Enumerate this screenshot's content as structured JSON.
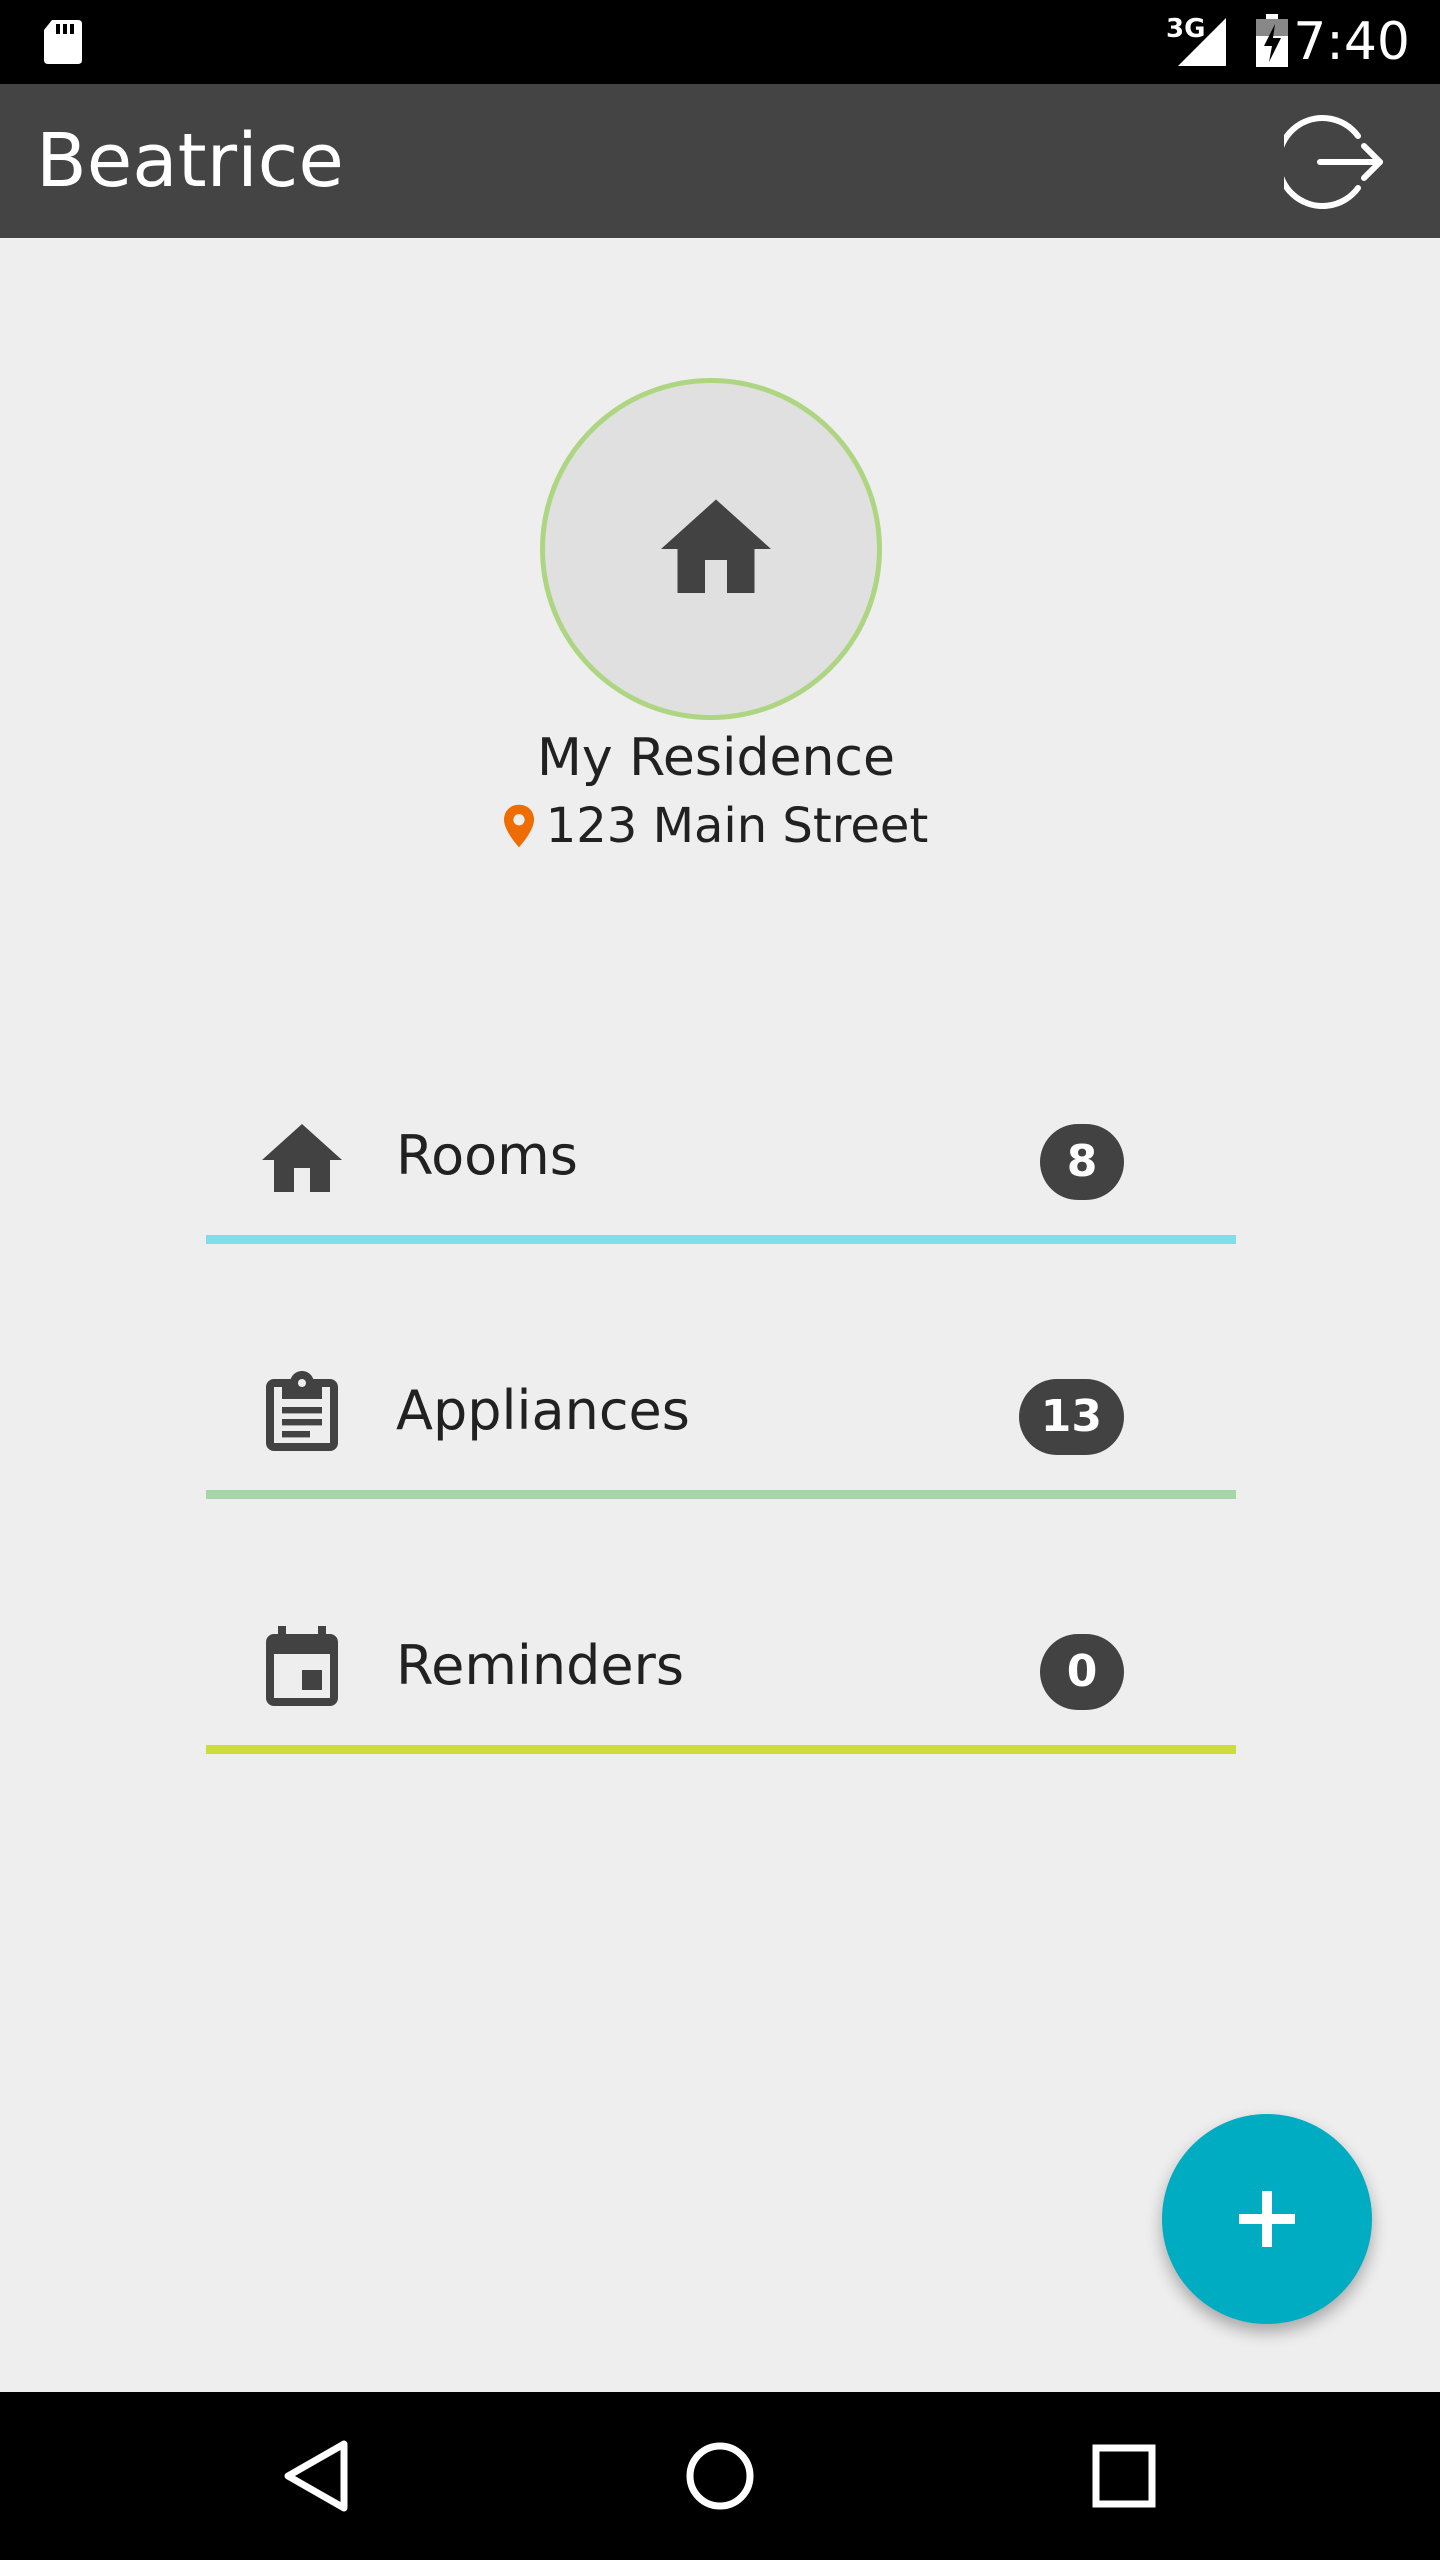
{
  "status_bar": {
    "network_type": "3G",
    "time": "7:40"
  },
  "app_bar": {
    "title": "Beatrice",
    "logout_icon": "logout-icon"
  },
  "residence": {
    "name": "My Residence",
    "address": "123 Main Street",
    "avatar_icon": "home-icon",
    "avatar_border_color": "#aed581",
    "pin_color": "#ef6c00"
  },
  "menu": [
    {
      "label": "Rooms",
      "count": "8",
      "icon": "home-icon",
      "accent_color": "#80deea"
    },
    {
      "label": "Appliances",
      "count": "13",
      "icon": "clipboard-icon",
      "accent_color": "#a5d6a7"
    },
    {
      "label": "Reminders",
      "count": "0",
      "icon": "calendar-icon",
      "accent_color": "#cddc39"
    }
  ],
  "fab": {
    "icon": "plus-icon",
    "color": "#00acc1"
  },
  "nav_bar": {
    "back_icon": "back-icon",
    "home_icon": "home-circle-icon",
    "recents_icon": "recents-icon"
  }
}
